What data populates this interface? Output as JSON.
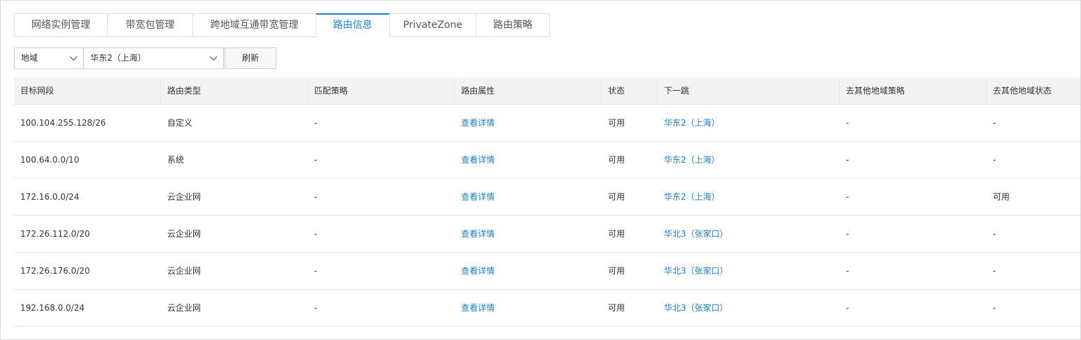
{
  "tabs": [
    {
      "label": "网络实例管理",
      "active": false
    },
    {
      "label": "带宽包管理",
      "active": false
    },
    {
      "label": "跨地域互通带宽管理",
      "active": false
    },
    {
      "label": "路由信息",
      "active": true
    },
    {
      "label": "PrivateZone",
      "active": false
    },
    {
      "label": "路由策略",
      "active": false
    }
  ],
  "toolbar": {
    "filter_type": "地域",
    "region": "华东2（上海）",
    "refresh_label": "刷新"
  },
  "colors": {
    "accent": "#1d7fc9",
    "header_bg": "#f3f3f3",
    "border": "#dddddd"
  },
  "table": {
    "columns": [
      "目标网段",
      "路由类型",
      "匹配策略",
      "路由属性",
      "状态",
      "下一跳",
      "去其他地域策略",
      "去其他地域状态"
    ],
    "rows": [
      [
        "100.104.255.128/26",
        "自定义",
        "-",
        "查看详情",
        "可用",
        "华东2（上海）",
        "-",
        "-"
      ],
      [
        "100.64.0.0/10",
        "系统",
        "-",
        "查看详情",
        "可用",
        "华东2（上海）",
        "-",
        "-"
      ],
      [
        "172.16.0.0/24",
        "云企业网",
        "-",
        "查看详情",
        "可用",
        "华东2（上海）",
        "-",
        "可用"
      ],
      [
        "172.26.112.0/20",
        "云企业网",
        "-",
        "查看详情",
        "可用",
        "华北3（张家口）",
        "-",
        "-"
      ],
      [
        "172.26.176.0/20",
        "云企业网",
        "-",
        "查看详情",
        "可用",
        "华北3（张家口）",
        "-",
        "-"
      ],
      [
        "192.168.0.0/24",
        "云企业网",
        "-",
        "查看详情",
        "可用",
        "华北3（张家口）",
        "-",
        "-"
      ]
    ]
  }
}
